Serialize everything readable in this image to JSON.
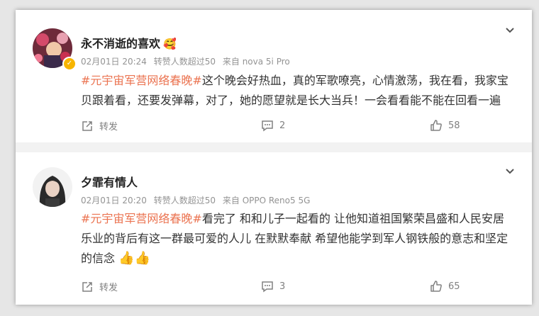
{
  "posts": [
    {
      "username": "永不消逝的喜欢",
      "name_emoji": "🥰",
      "date": "02月01日 20:24",
      "likes_info": "转赞人数超过50",
      "source": "来自 nova 5i Pro",
      "hashtag": "#元宇宙军营网络春晚#",
      "text": "这个晚会好热血，真的军歌嘹亮，心情激荡，我在看，我家宝贝跟着看，还要发弹幕，对了，她的愿望就是长大当兵！一会看看能不能在回看一遍",
      "repost_label": "转发",
      "comment_count": "2",
      "like_count": "58"
    },
    {
      "username": "夕霏有情人",
      "date": "02月01日 20:20",
      "likes_info": "转赞人数超过50",
      "source": "来自 OPPO Reno5 5G",
      "hashtag": "#元宇宙军营网络春晚#",
      "text": "看完了 和和儿子一起看的 让他知道祖国繁荣昌盛和人民安居乐业的背后有这一群最可爱的人儿 在默默奉献 希望他能学到军人钢铁般的意志和坚定的信念",
      "emojis": "👍👍",
      "repost_label": "转发",
      "comment_count": "3",
      "like_count": "65"
    }
  ],
  "colors": {
    "hashtag": "#eb7350",
    "meta": "#939393",
    "badge": "#f7b500"
  }
}
